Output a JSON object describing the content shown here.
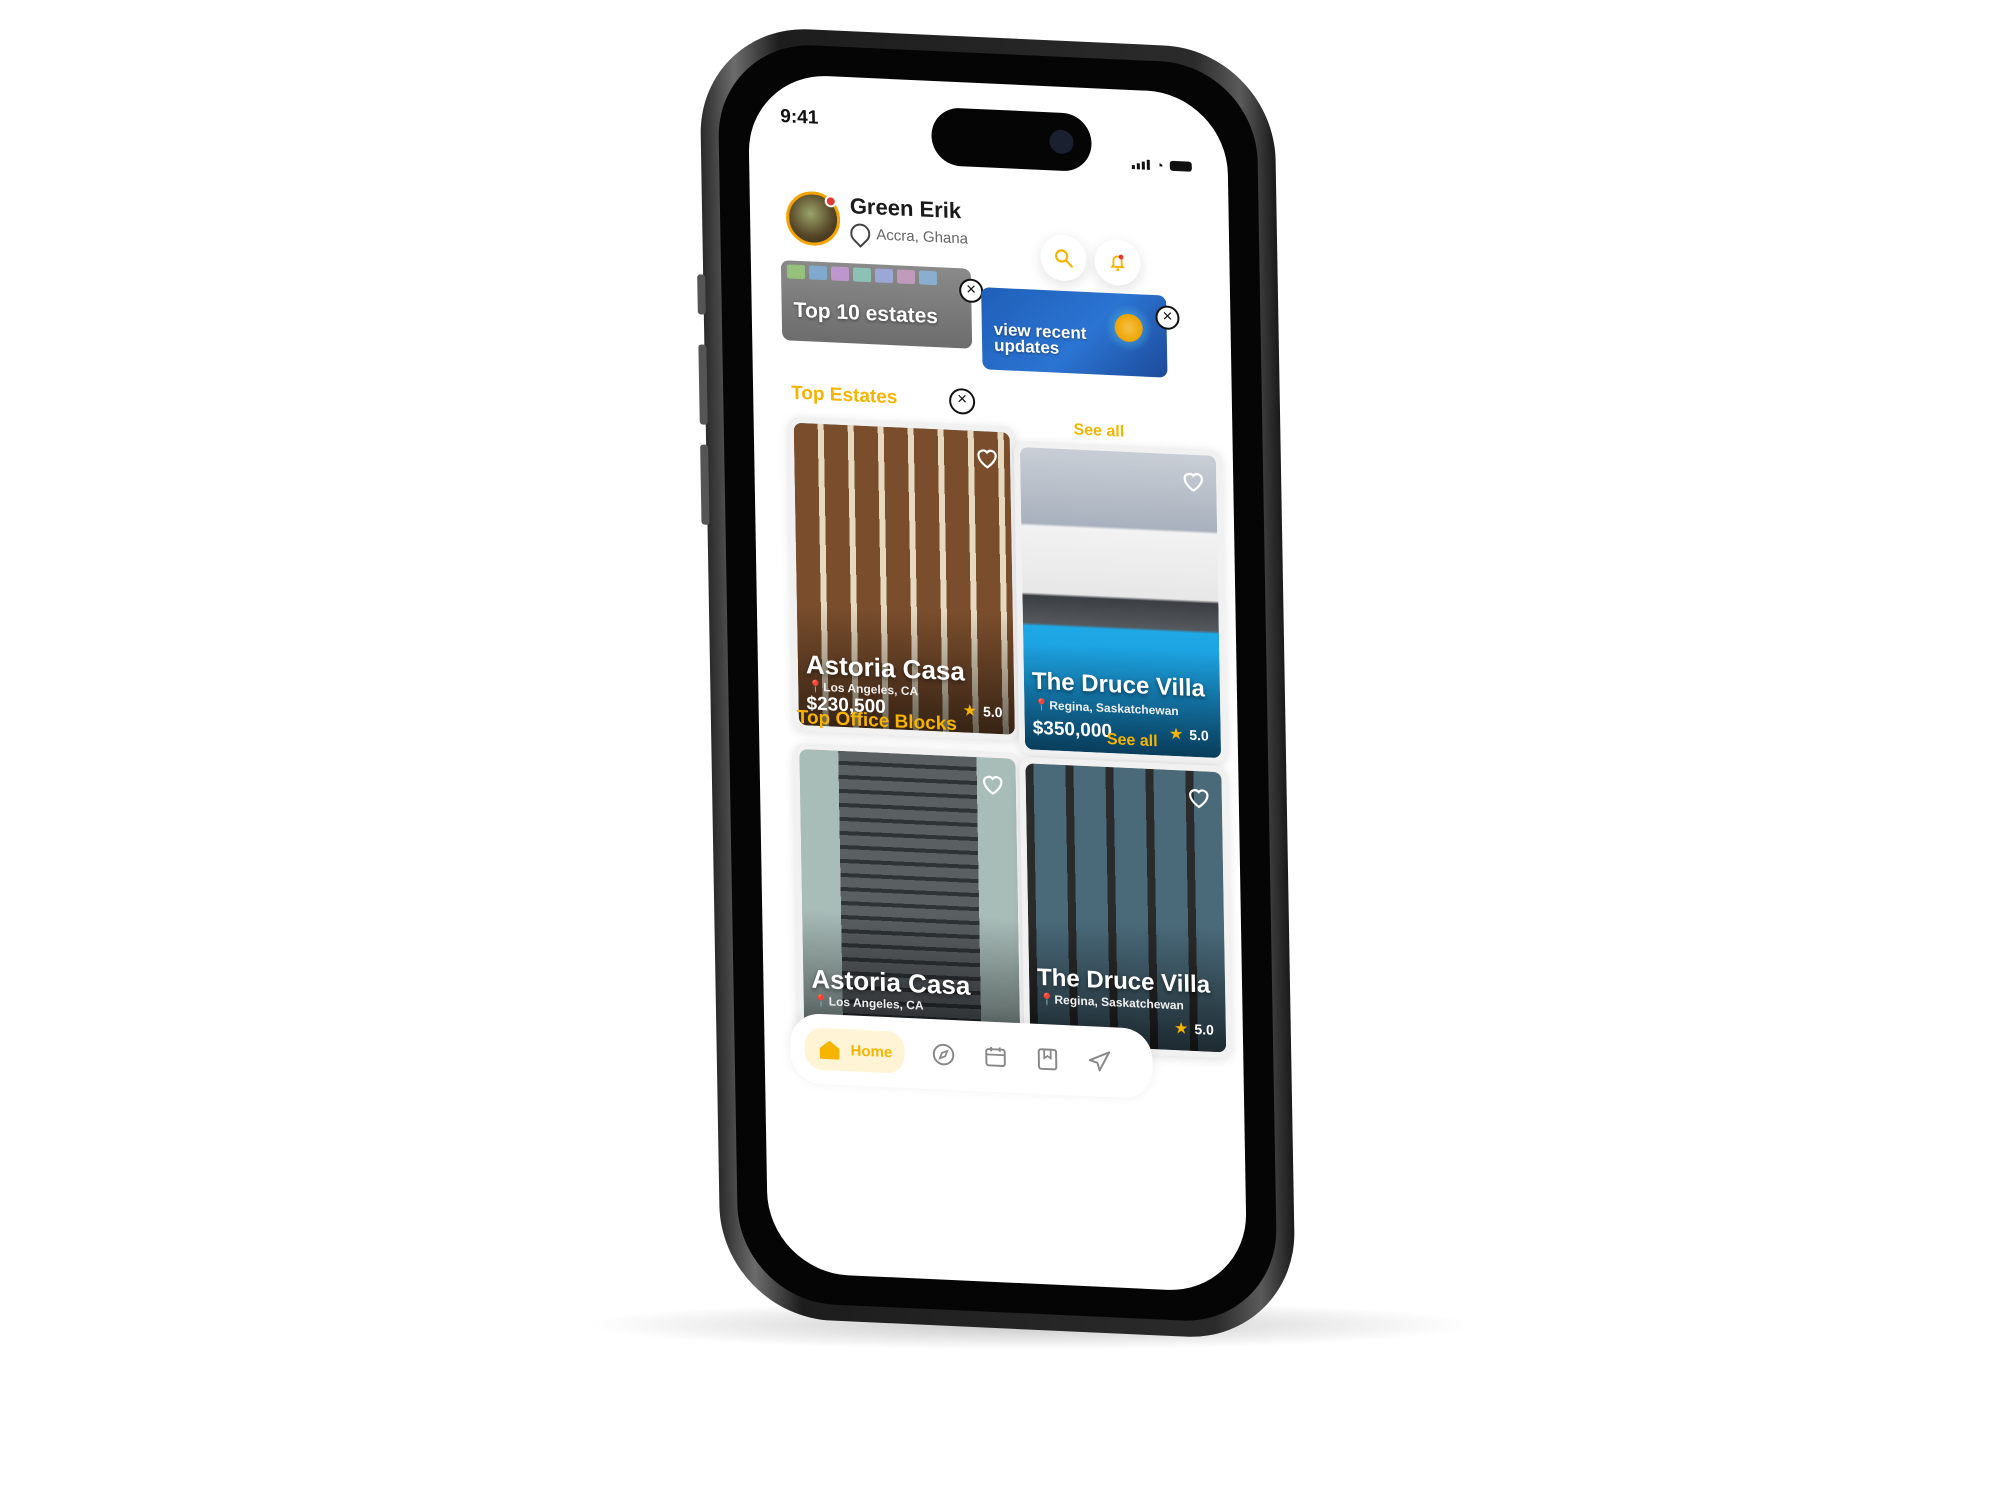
{
  "status_bar": {
    "time": "9:41"
  },
  "user": {
    "name": "Green Erik",
    "location": "Accra, Ghana"
  },
  "banners": [
    {
      "label": "Top 10 estates"
    },
    {
      "label_line1": "view recent",
      "label_line2": "updates"
    }
  ],
  "sections": {
    "top_estates": {
      "title": "Top Estates",
      "see_all": "See all"
    },
    "top_office_blocks": {
      "title": "Top Office Blocks",
      "see_all": "See all"
    }
  },
  "estate_cards": [
    {
      "name": "Astoria Casa",
      "location": "Los Angeles, CA",
      "price": "$230,500",
      "rating": "5.0"
    },
    {
      "name": "The Druce Villa",
      "location": "Regina, Saskatchewan",
      "price": "$350,000",
      "rating": "5.0"
    }
  ],
  "office_cards": [
    {
      "name": "Astoria Casa",
      "location": "Los Angeles, CA"
    },
    {
      "name": "The Druce Villa",
      "location": "Regina, Saskatchewan",
      "rating": "5.0"
    }
  ],
  "bottom_nav": {
    "home_label": "Home",
    "items": [
      "home-icon",
      "compass-icon",
      "calendar-icon",
      "bookmark-icon",
      "send-icon"
    ]
  },
  "colors": {
    "accent": "#f5b400",
    "badge": "#e53935",
    "banner_blue": "#2b74d2"
  }
}
